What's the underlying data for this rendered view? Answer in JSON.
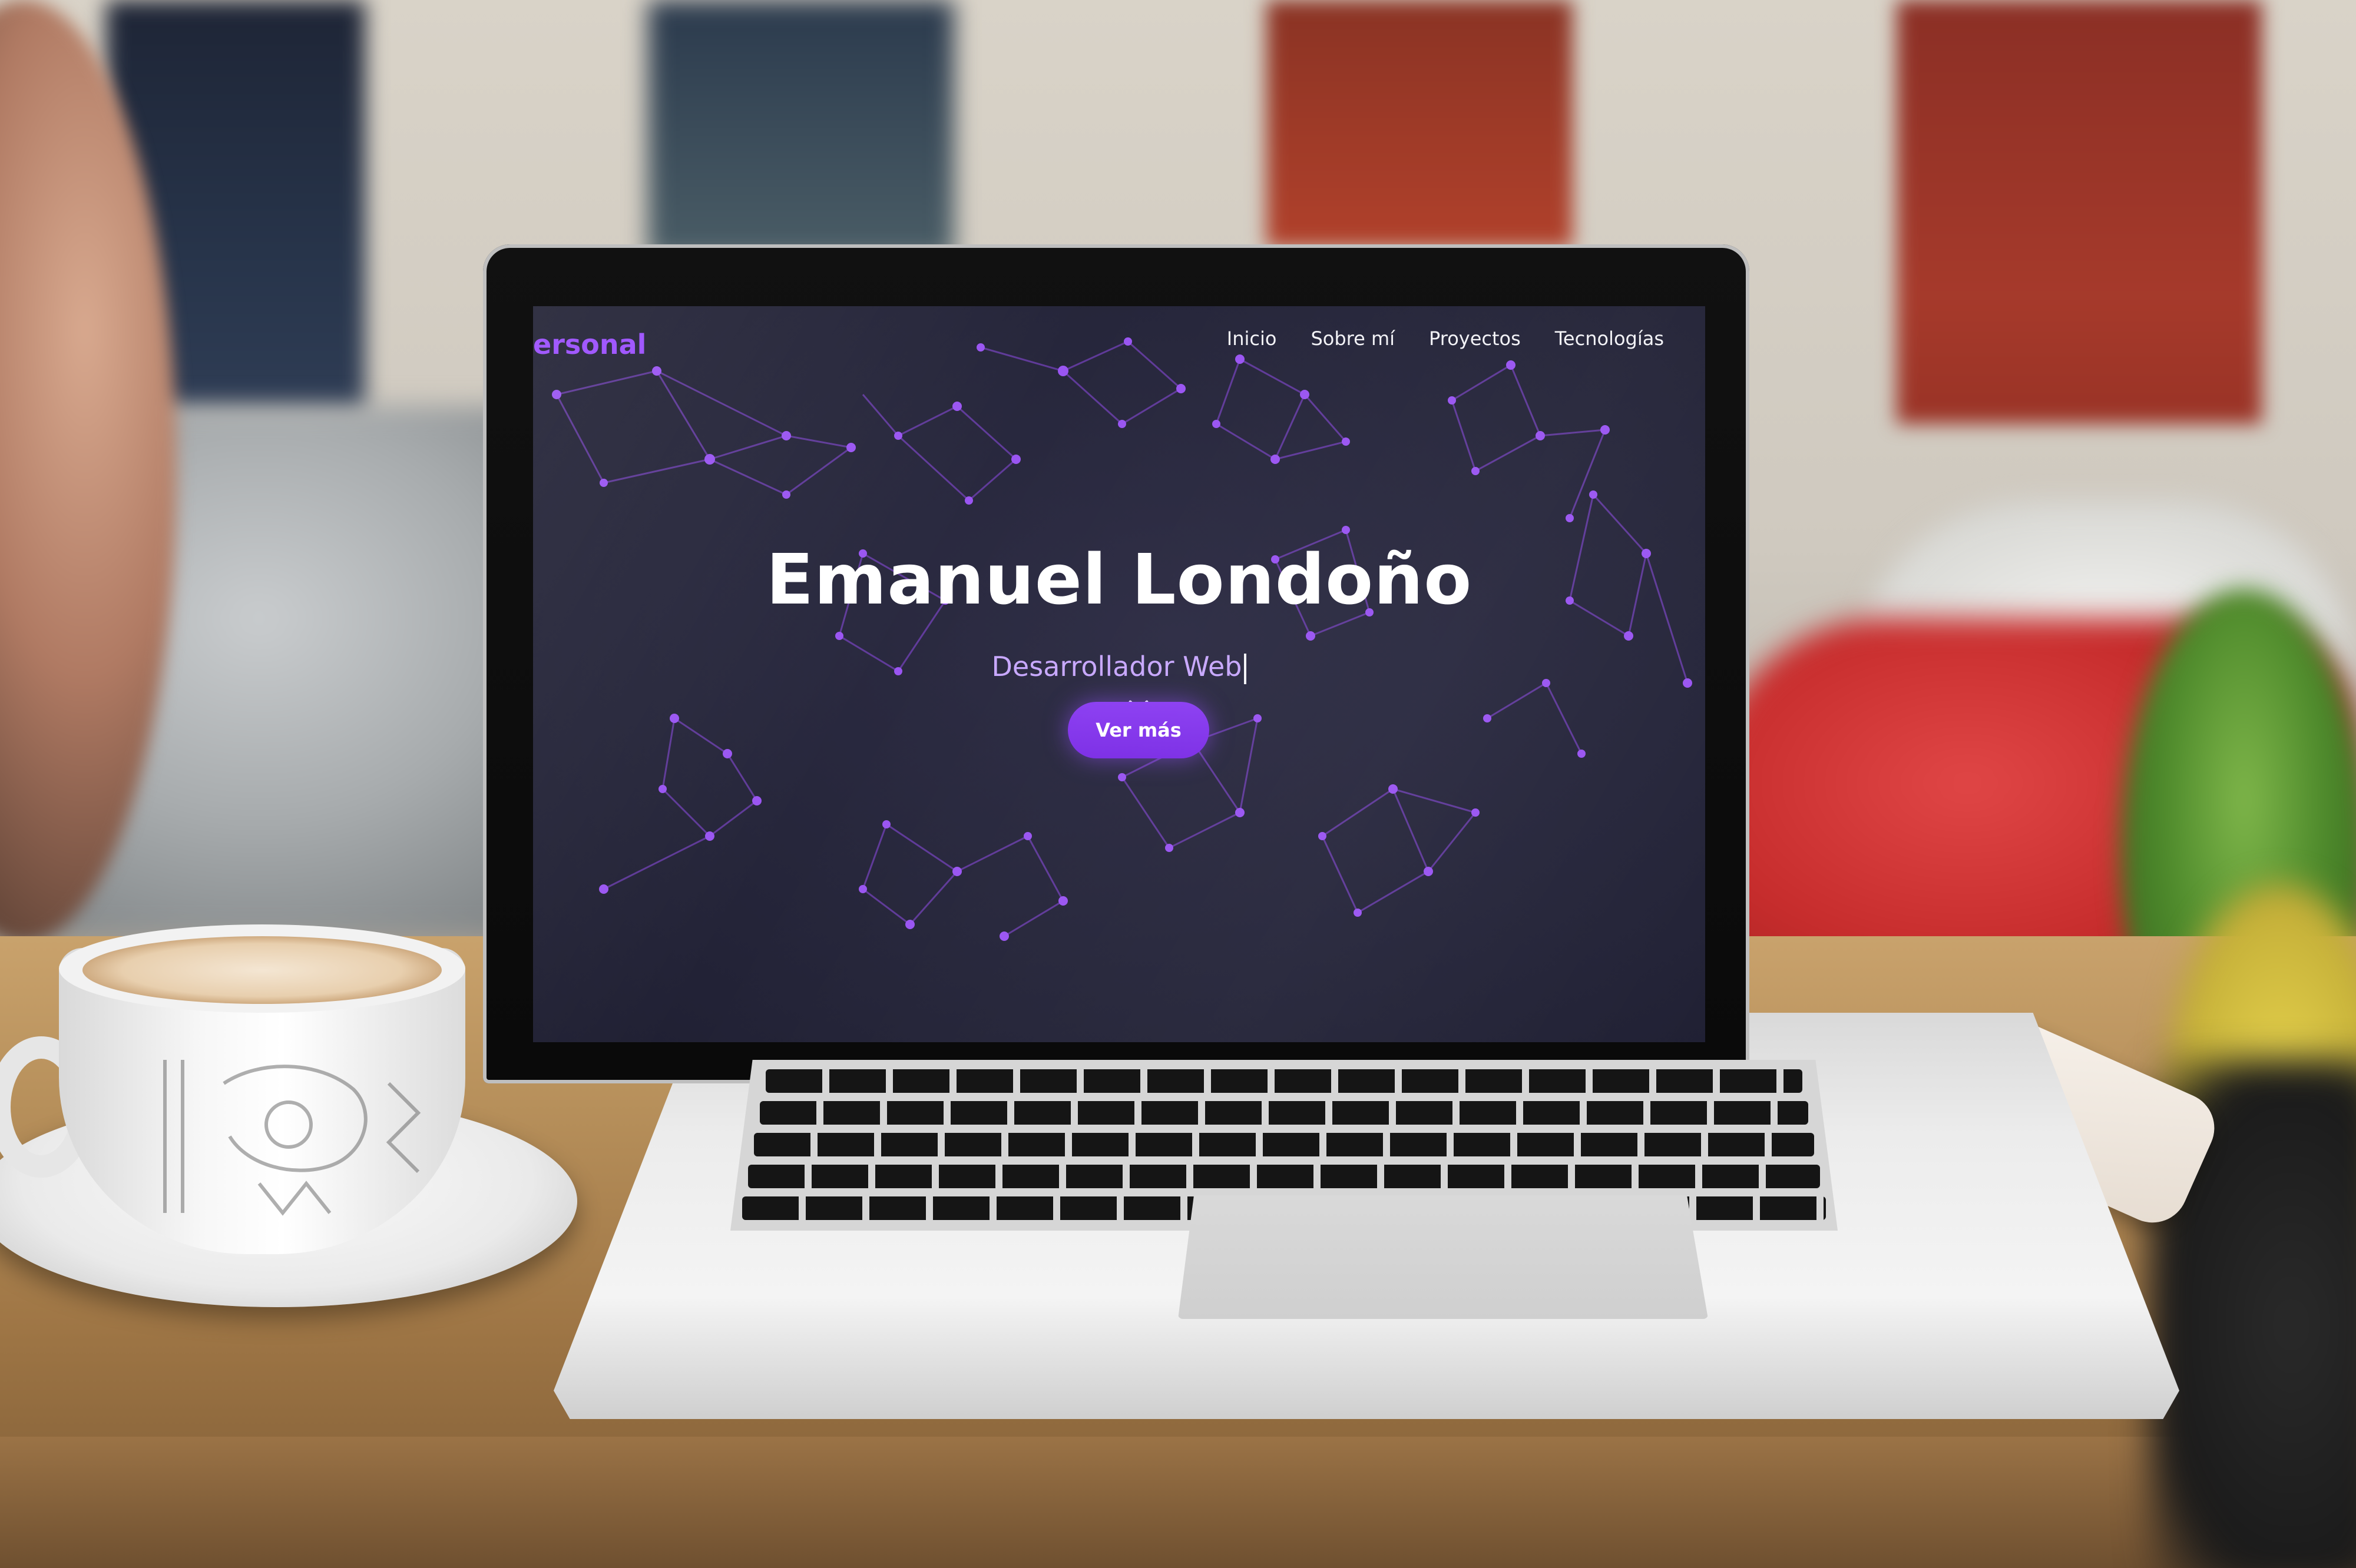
{
  "site": {
    "brand": "ersonal",
    "nav": [
      {
        "label": "Inicio"
      },
      {
        "label": "Sobre mí"
      },
      {
        "label": "Proyectos"
      },
      {
        "label": "Tecnologías"
      }
    ],
    "hero": {
      "title": "Emanuel Londoño",
      "subtitle": "Desarrollador Web"
    },
    "cta": {
      "label": "Ver más"
    }
  },
  "icons": {
    "scroll_hint": "chevron-down-icon"
  },
  "colors": {
    "accent": "#8C3FF2",
    "brand": "#9A4DFF",
    "background": "#26263B",
    "subtitle": "#C8A8FF",
    "network": "#8E4BE6"
  }
}
